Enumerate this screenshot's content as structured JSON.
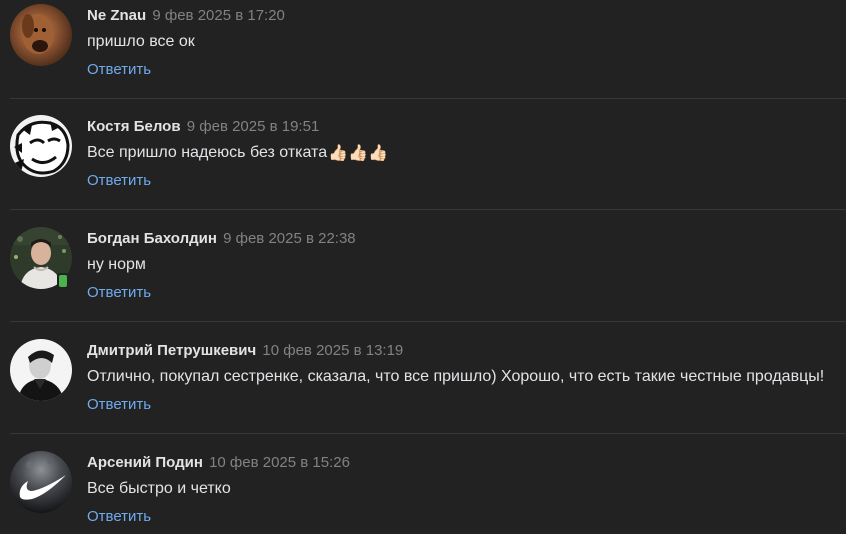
{
  "comments": [
    {
      "author": "Ne Znau",
      "date": "9 фев 2025 в 17:20",
      "text": "пришло все ок",
      "emoji": "",
      "reply_label": "Ответить",
      "avatar_icon": "dog-avatar",
      "online_mobile": false
    },
    {
      "author": "Костя Белов",
      "date": "9 фев 2025 в 19:51",
      "text": "Все пришло надеюсь без отката",
      "emoji": "👍🏻👍🏻👍🏻",
      "reply_label": "Ответить",
      "avatar_icon": "cartoon-face-avatar",
      "online_mobile": false
    },
    {
      "author": "Богдан Бахолдин",
      "date": "9 фев 2025 в 22:38",
      "text": "ну норм",
      "emoji": "",
      "reply_label": "Ответить",
      "avatar_icon": "person-photo-avatar",
      "online_mobile": true
    },
    {
      "author": "Дмитрий Петрушкевич",
      "date": "10 фев 2025 в 13:19",
      "text": "Отлично, покупал сестренке, сказала, что все пришло) Хорошо, что есть такие честные продавцы!",
      "emoji": "",
      "reply_label": "Ответить",
      "avatar_icon": "bw-portrait-avatar",
      "online_mobile": false
    },
    {
      "author": "Арсений Подин",
      "date": "10 фев 2025 в 15:26",
      "text": "Все быстро и четко",
      "emoji": "",
      "reply_label": "Ответить",
      "avatar_icon": "swoosh-logo-avatar",
      "online_mobile": false
    }
  ],
  "colors": {
    "background": "#222222",
    "text": "#e1e3e6",
    "secondary_text": "#828282",
    "link": "#71aaeb",
    "divider": "#363738",
    "online": "#4bb34b"
  }
}
